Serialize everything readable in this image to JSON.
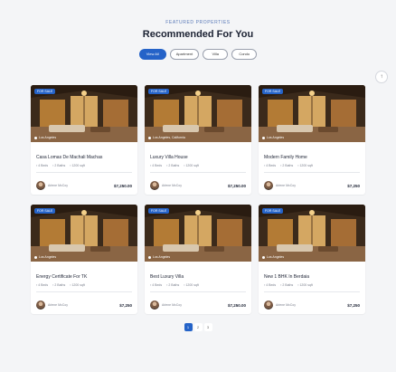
{
  "header": {
    "eyebrow": "FEATURED PROPERTIES",
    "title": "Recommended For You"
  },
  "tabs": [
    {
      "label": "View All",
      "active": true
    },
    {
      "label": "Apartment",
      "active": false
    },
    {
      "label": "Villa",
      "active": false
    },
    {
      "label": "Condo",
      "active": false
    }
  ],
  "side_button": {
    "icon": "arrow-up-icon",
    "glyph": "↑"
  },
  "cards": [
    {
      "badge": "FOR SALE",
      "location": "Los Angeles",
      "name": "Casa Lomas De Machali Machas",
      "beds": "4 Beds",
      "baths": "2 Baths",
      "area": "1200 sqft",
      "agent": "Arlene McCoy",
      "price": "$7,250.00"
    },
    {
      "badge": "FOR SALE",
      "location": "Los Angeles, California",
      "name": "Luxury Villa House",
      "beds": "4 Beds",
      "baths": "2 Baths",
      "area": "1200 sqft",
      "agent": "Arlene McCoy",
      "price": "$7,250.00"
    },
    {
      "badge": "FOR SALE",
      "location": "Los Angeles",
      "name": "Modern Family Home",
      "beds": "4 Beds",
      "baths": "2 Baths",
      "area": "1200 sqft",
      "agent": "Arlene McCoy",
      "price": "$7,250"
    },
    {
      "badge": "FOR SALE",
      "location": "Los Angeles",
      "name": "Energy Certificate For TK",
      "beds": "4 Beds",
      "baths": "2 Baths",
      "area": "1200 sqft",
      "agent": "Arlene McCoy",
      "price": "$7,250"
    },
    {
      "badge": "FOR SALE",
      "location": "Los Angeles",
      "name": "Best Luxury Villa",
      "beds": "4 Beds",
      "baths": "2 Baths",
      "area": "1200 sqft",
      "agent": "Arlene McCoy",
      "price": "$7,250.00"
    },
    {
      "badge": "FOR SALE",
      "location": "Los Angeles",
      "name": "New 1 BHK In Berdaia",
      "beds": "4 Beds",
      "baths": "2 Baths",
      "area": "1200 sqft",
      "agent": "Arlene McCoy",
      "price": "$7,250"
    }
  ],
  "pagination": [
    "1",
    "2",
    "3"
  ],
  "colors": {
    "accent": "#2563c8",
    "background": "#f4f5f7"
  }
}
